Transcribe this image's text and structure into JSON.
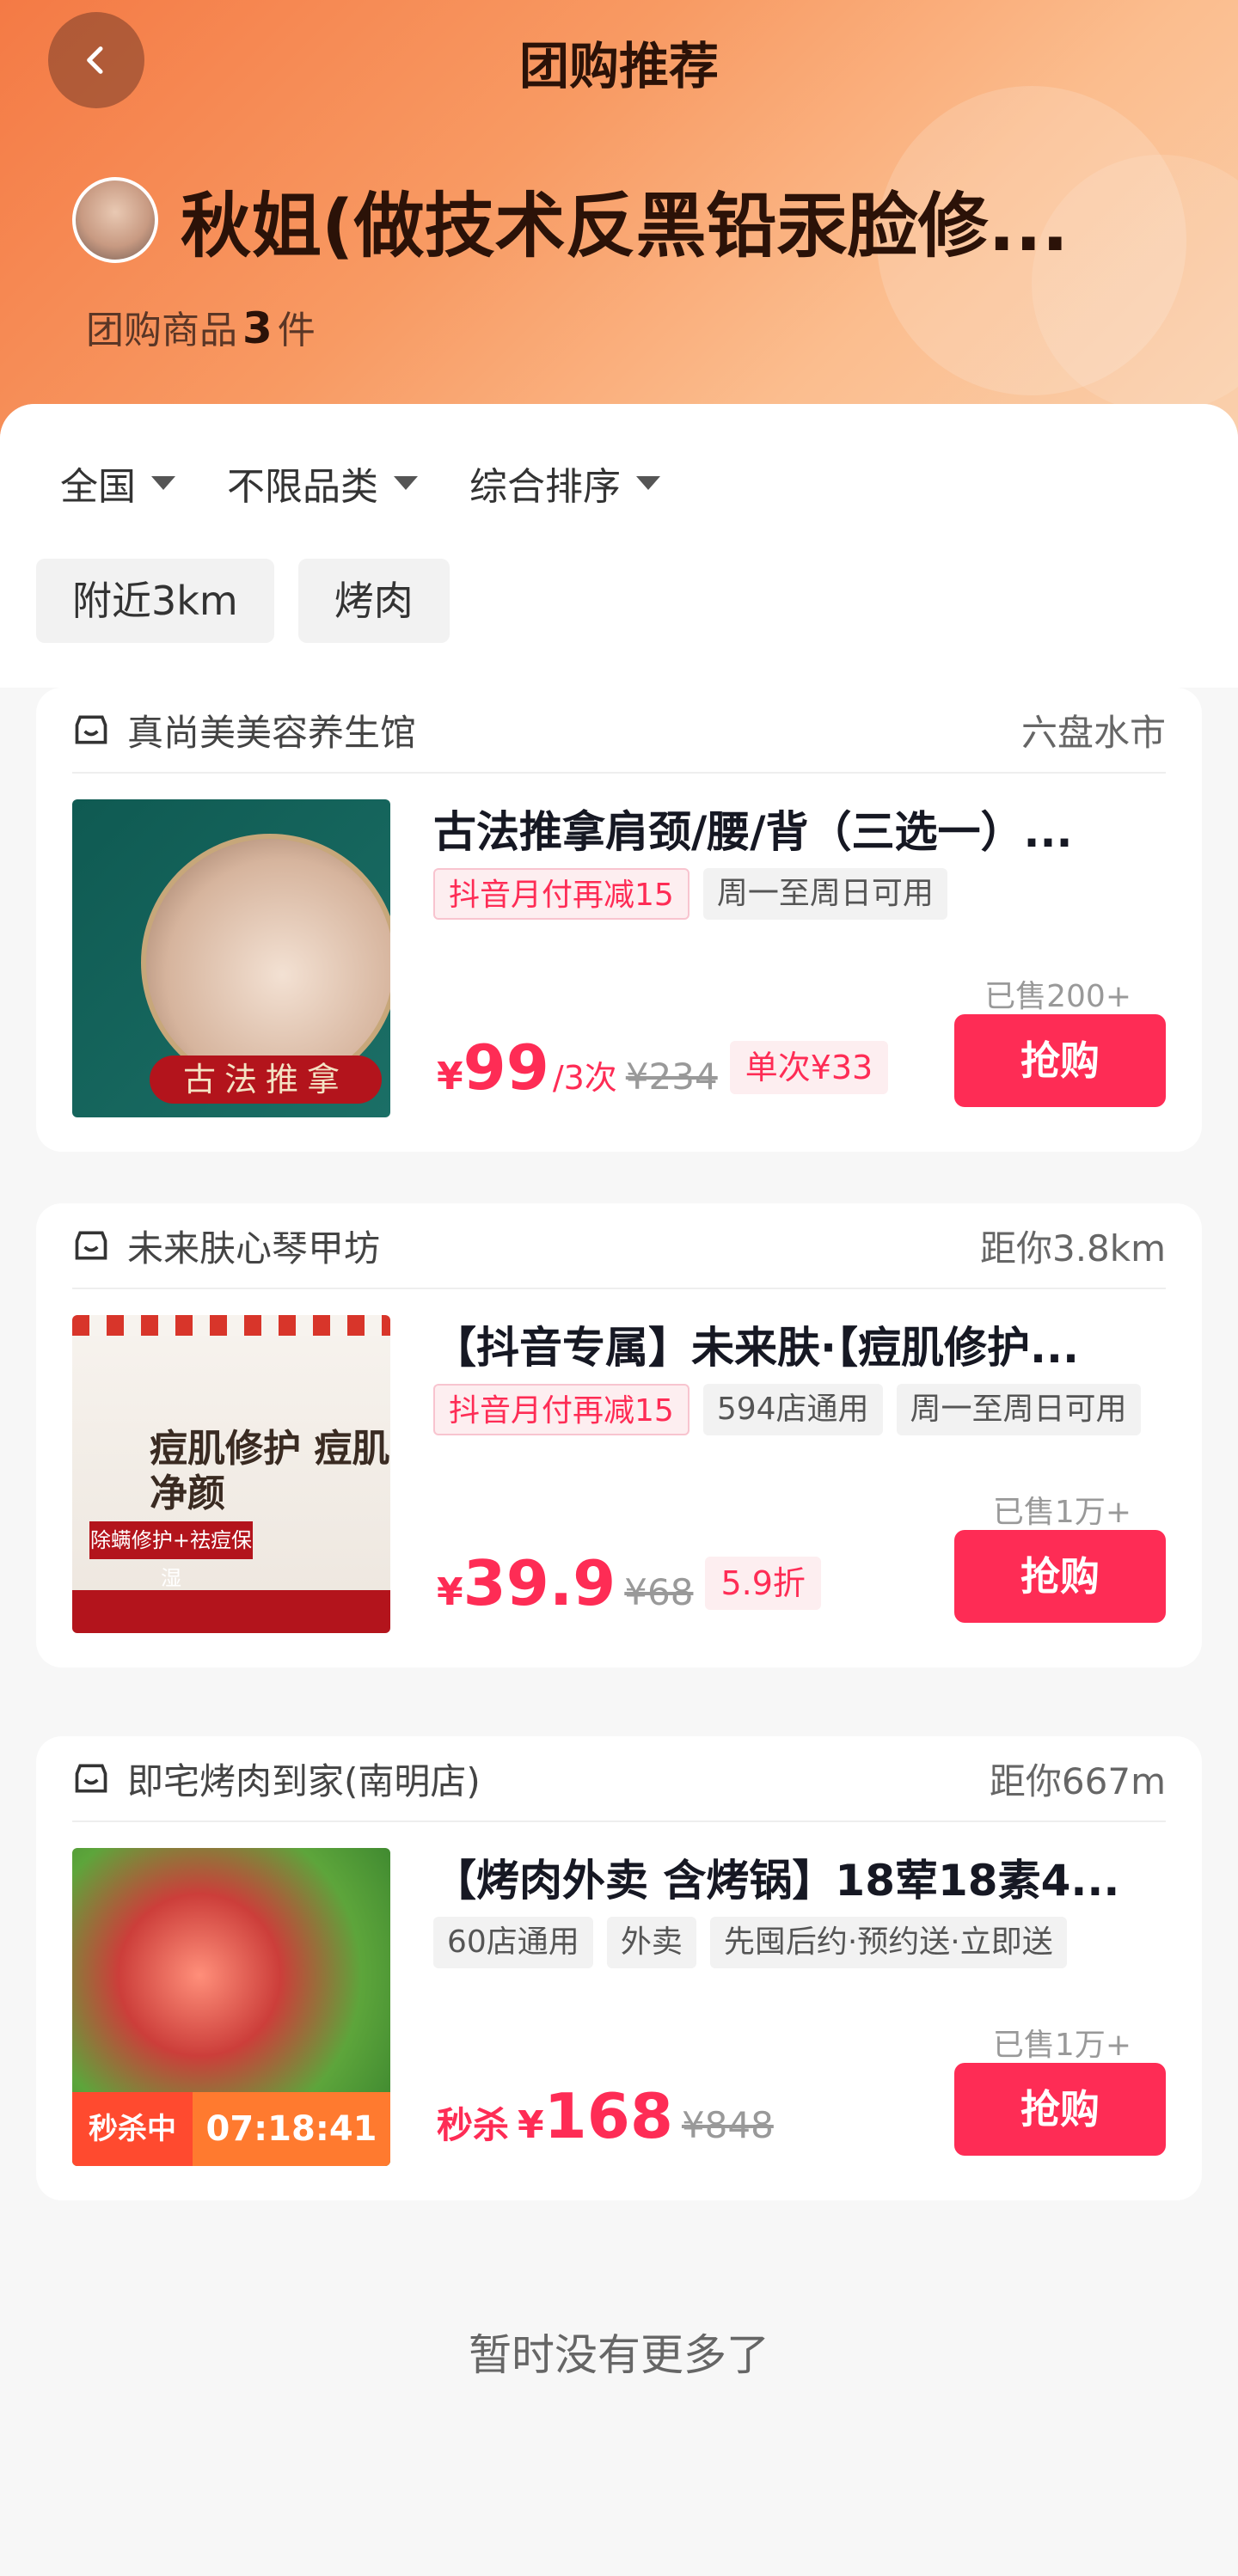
{
  "header": {
    "title": "团购推荐",
    "shop_name": "秋姐(做技术反黑铅汞脸修...",
    "goods_count_prefix": "团购商品",
    "goods_count": "3",
    "goods_count_suffix": "件"
  },
  "filters": [
    {
      "label": "全国"
    },
    {
      "label": "不限品类"
    },
    {
      "label": "综合排序"
    }
  ],
  "chips": [
    "附近3km",
    "烤肉"
  ],
  "items": [
    {
      "store": "真尚美美容养生馆",
      "distance": "六盘水市",
      "title": "古法推拿肩颈/腰/背（三选一）...",
      "tags": [
        {
          "text": "抖音月付再减15",
          "style": "red"
        },
        {
          "text": "周一至周日可用",
          "style": "gray"
        }
      ],
      "sold": "已售200+",
      "price_prefix": "",
      "yen": "¥",
      "price": "99",
      "unit": "/3次",
      "original": "¥234",
      "discount": "单次¥33",
      "buy": "抢购",
      "thumb_text": "古法推拿"
    },
    {
      "store": "未来肤心琴甲坊",
      "distance": "距你3.8km",
      "title": "【抖音专属】未来肤·【痘肌修护...",
      "tags": [
        {
          "text": "抖音月付再减15",
          "style": "red"
        },
        {
          "text": "594店通用",
          "style": "gray"
        },
        {
          "text": "周一至周日可用",
          "style": "gray"
        }
      ],
      "sold": "已售1万+",
      "price_prefix": "",
      "yen": "¥",
      "price": "39.9",
      "unit": "",
      "original": "¥68",
      "discount": "5.9折",
      "buy": "抢购",
      "thumb_text": "痘肌修护 痘肌净颜",
      "thumb_bar": "除螨修护+祛痘保湿"
    },
    {
      "store": "即宅烤肉到家(南明店)",
      "distance": "距你667m",
      "title": "【烤肉外卖 含烤锅】18荤18素4...",
      "tags": [
        {
          "text": "60店通用",
          "style": "gray"
        },
        {
          "text": "外卖",
          "style": "gray"
        },
        {
          "text": "先囤后约·预约送·立即送",
          "style": "gray"
        }
      ],
      "sold": "已售1万+",
      "price_prefix": "秒杀",
      "yen": "¥",
      "price": "168",
      "unit": "",
      "original": "¥848",
      "discount": "",
      "buy": "抢购",
      "flash_label": "秒杀中",
      "flash_time": "07:18:41"
    }
  ],
  "footer": {
    "no_more": "暂时没有更多了"
  }
}
